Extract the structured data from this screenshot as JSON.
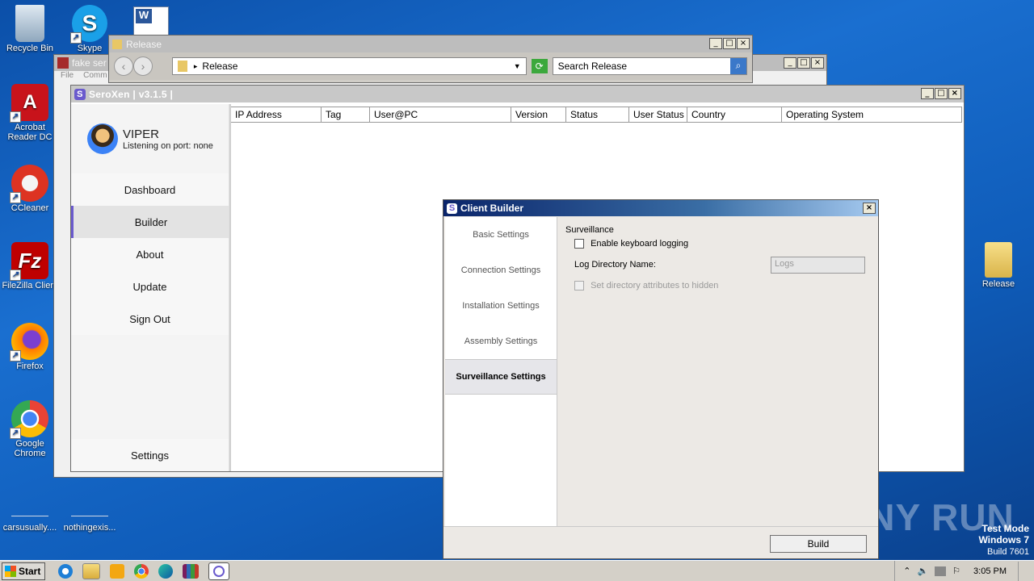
{
  "desktop": {
    "icons": [
      {
        "label": "Recycle Bin"
      },
      {
        "label": "Skype"
      },
      {
        "label": "Acrobat Reader DC"
      },
      {
        "label": "CCleaner"
      },
      {
        "label": "FileZilla Client"
      },
      {
        "label": "Firefox"
      },
      {
        "label": "Google Chrome"
      },
      {
        "label": "Release"
      },
      {
        "label": "carsusually...."
      },
      {
        "label": "nothingexis..."
      }
    ],
    "watermark": {
      "logo": "ANY RUN",
      "mode": "Test Mode",
      "os": "Windows 7",
      "build": "Build 7601"
    }
  },
  "bg_window": {
    "title": "fake ser",
    "menu": [
      "File",
      "Comm"
    ]
  },
  "explorer": {
    "title": "Release",
    "address": "Release",
    "search_placeholder": "Search Release"
  },
  "seroxen": {
    "title": "SeroXen | v3.1.5 |",
    "user": {
      "name": "VIPER",
      "status": "Listening on port: none"
    },
    "nav": [
      {
        "label": "Dashboard"
      },
      {
        "label": "Builder"
      },
      {
        "label": "About"
      },
      {
        "label": "Update"
      },
      {
        "label": "Sign Out"
      }
    ],
    "settings_label": "Settings",
    "columns": [
      "IP Address",
      "Tag",
      "User@PC",
      "Version",
      "Status",
      "User Status",
      "Country",
      "Operating System"
    ]
  },
  "builder": {
    "title": "Client Builder",
    "tabs": [
      {
        "label": "Basic Settings"
      },
      {
        "label": "Connection Settings"
      },
      {
        "label": "Installation Settings"
      },
      {
        "label": "Assembly Settings"
      },
      {
        "label": "Surveillance Settings"
      }
    ],
    "section": "Surveillance",
    "keylog_label": "Enable keyboard logging",
    "logdir_label": "Log Directory Name:",
    "logdir_placeholder": "Logs",
    "hidden_label": "Set directory attributes to hidden",
    "build_label": "Build"
  },
  "taskbar": {
    "start_label": "Start",
    "time": "3:05 PM"
  }
}
